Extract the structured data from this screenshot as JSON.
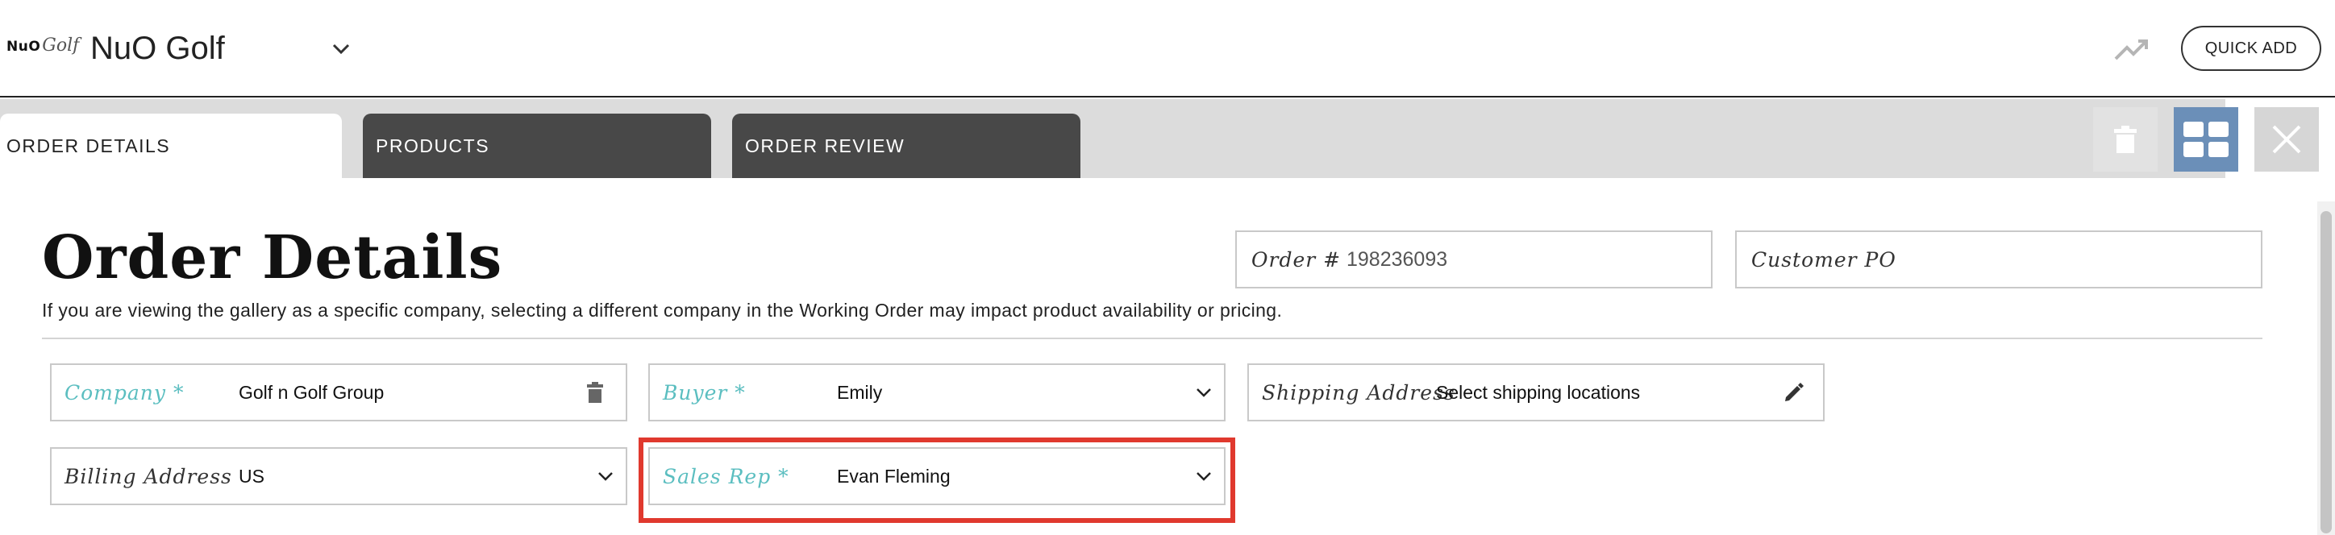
{
  "header": {
    "logo_primary": "NuO",
    "logo_secondary": "Golf",
    "app_title": "NuO Golf",
    "quick_add_label": "QUICK ADD"
  },
  "tabs": [
    {
      "label": "ORDER DETAILS",
      "active": true
    },
    {
      "label": "PRODUCTS",
      "active": false
    },
    {
      "label": "ORDER REVIEW",
      "active": false
    }
  ],
  "toolbar_icons": [
    "trash-icon",
    "grid-layout-icon",
    "close-icon"
  ],
  "main": {
    "title": "Order Details",
    "note": "If you are viewing the gallery as a specific company, selecting a different company in the Working Order may impact product availability or pricing.",
    "order_number": {
      "label": "Order #",
      "value": "198236093"
    },
    "customer_po": {
      "label": "Customer PO",
      "value": ""
    },
    "company": {
      "label": "Company *",
      "value": "Golf n Golf Group"
    },
    "buyer": {
      "label": "Buyer *",
      "value": "Emily"
    },
    "shipping_address": {
      "label": "Shipping Address",
      "value": "Select shipping locations"
    },
    "billing_address": {
      "label": "Billing Address",
      "value": "US"
    },
    "sales_rep": {
      "label": "Sales Rep *",
      "value": "Evan Fleming"
    }
  },
  "colors": {
    "required_label": "#5bbec0",
    "inactive_tab": "#484848",
    "grid_button": "#6b8fb8",
    "highlight": "#e0392e"
  }
}
